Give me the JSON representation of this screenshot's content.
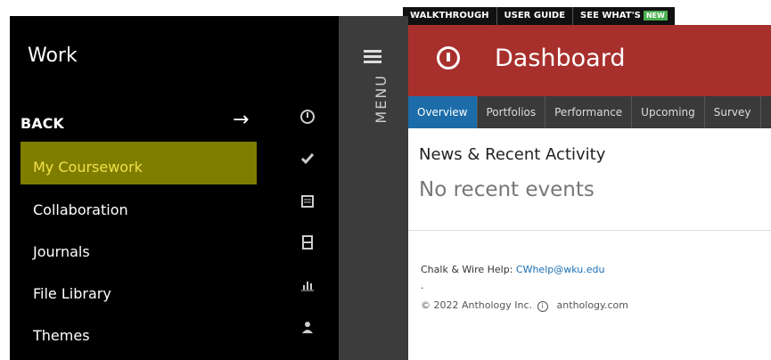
{
  "topbar": {
    "walkthrough": "WALKTHROUGH",
    "user_guide": "USER GUIDE",
    "see_whats": "SEE WHAT'S",
    "new_badge": "NEW"
  },
  "sidebar": {
    "title": "Work",
    "back_label": "BACK",
    "back_arrow": "→",
    "items": [
      {
        "label": "My Coursework",
        "highlighted": true
      },
      {
        "label": "Collaboration"
      },
      {
        "label": "Journals"
      },
      {
        "label": "File Library"
      },
      {
        "label": "Themes"
      }
    ],
    "icons": [
      "logo-icon",
      "check-icon",
      "book-icon",
      "cabinet-icon",
      "chart-icon",
      "users-icon"
    ]
  },
  "menu": {
    "label": "MENU"
  },
  "header": {
    "title": "Dashboard",
    "color": "#a8302c"
  },
  "tabs": [
    {
      "label": "Overview",
      "active": true
    },
    {
      "label": "Portfolios"
    },
    {
      "label": "Performance"
    },
    {
      "label": "Upcoming"
    },
    {
      "label": "Survey"
    }
  ],
  "main": {
    "news_title": "News & Recent Activity",
    "no_events": "No recent events",
    "help_prefix": "Chalk & Wire Help: ",
    "help_email": "CWhelp@wku.edu",
    "dot": ".",
    "copyright": "© 2022 Anthology Inc.",
    "info_glyph": "i",
    "anthology_link": "anthology.com"
  }
}
